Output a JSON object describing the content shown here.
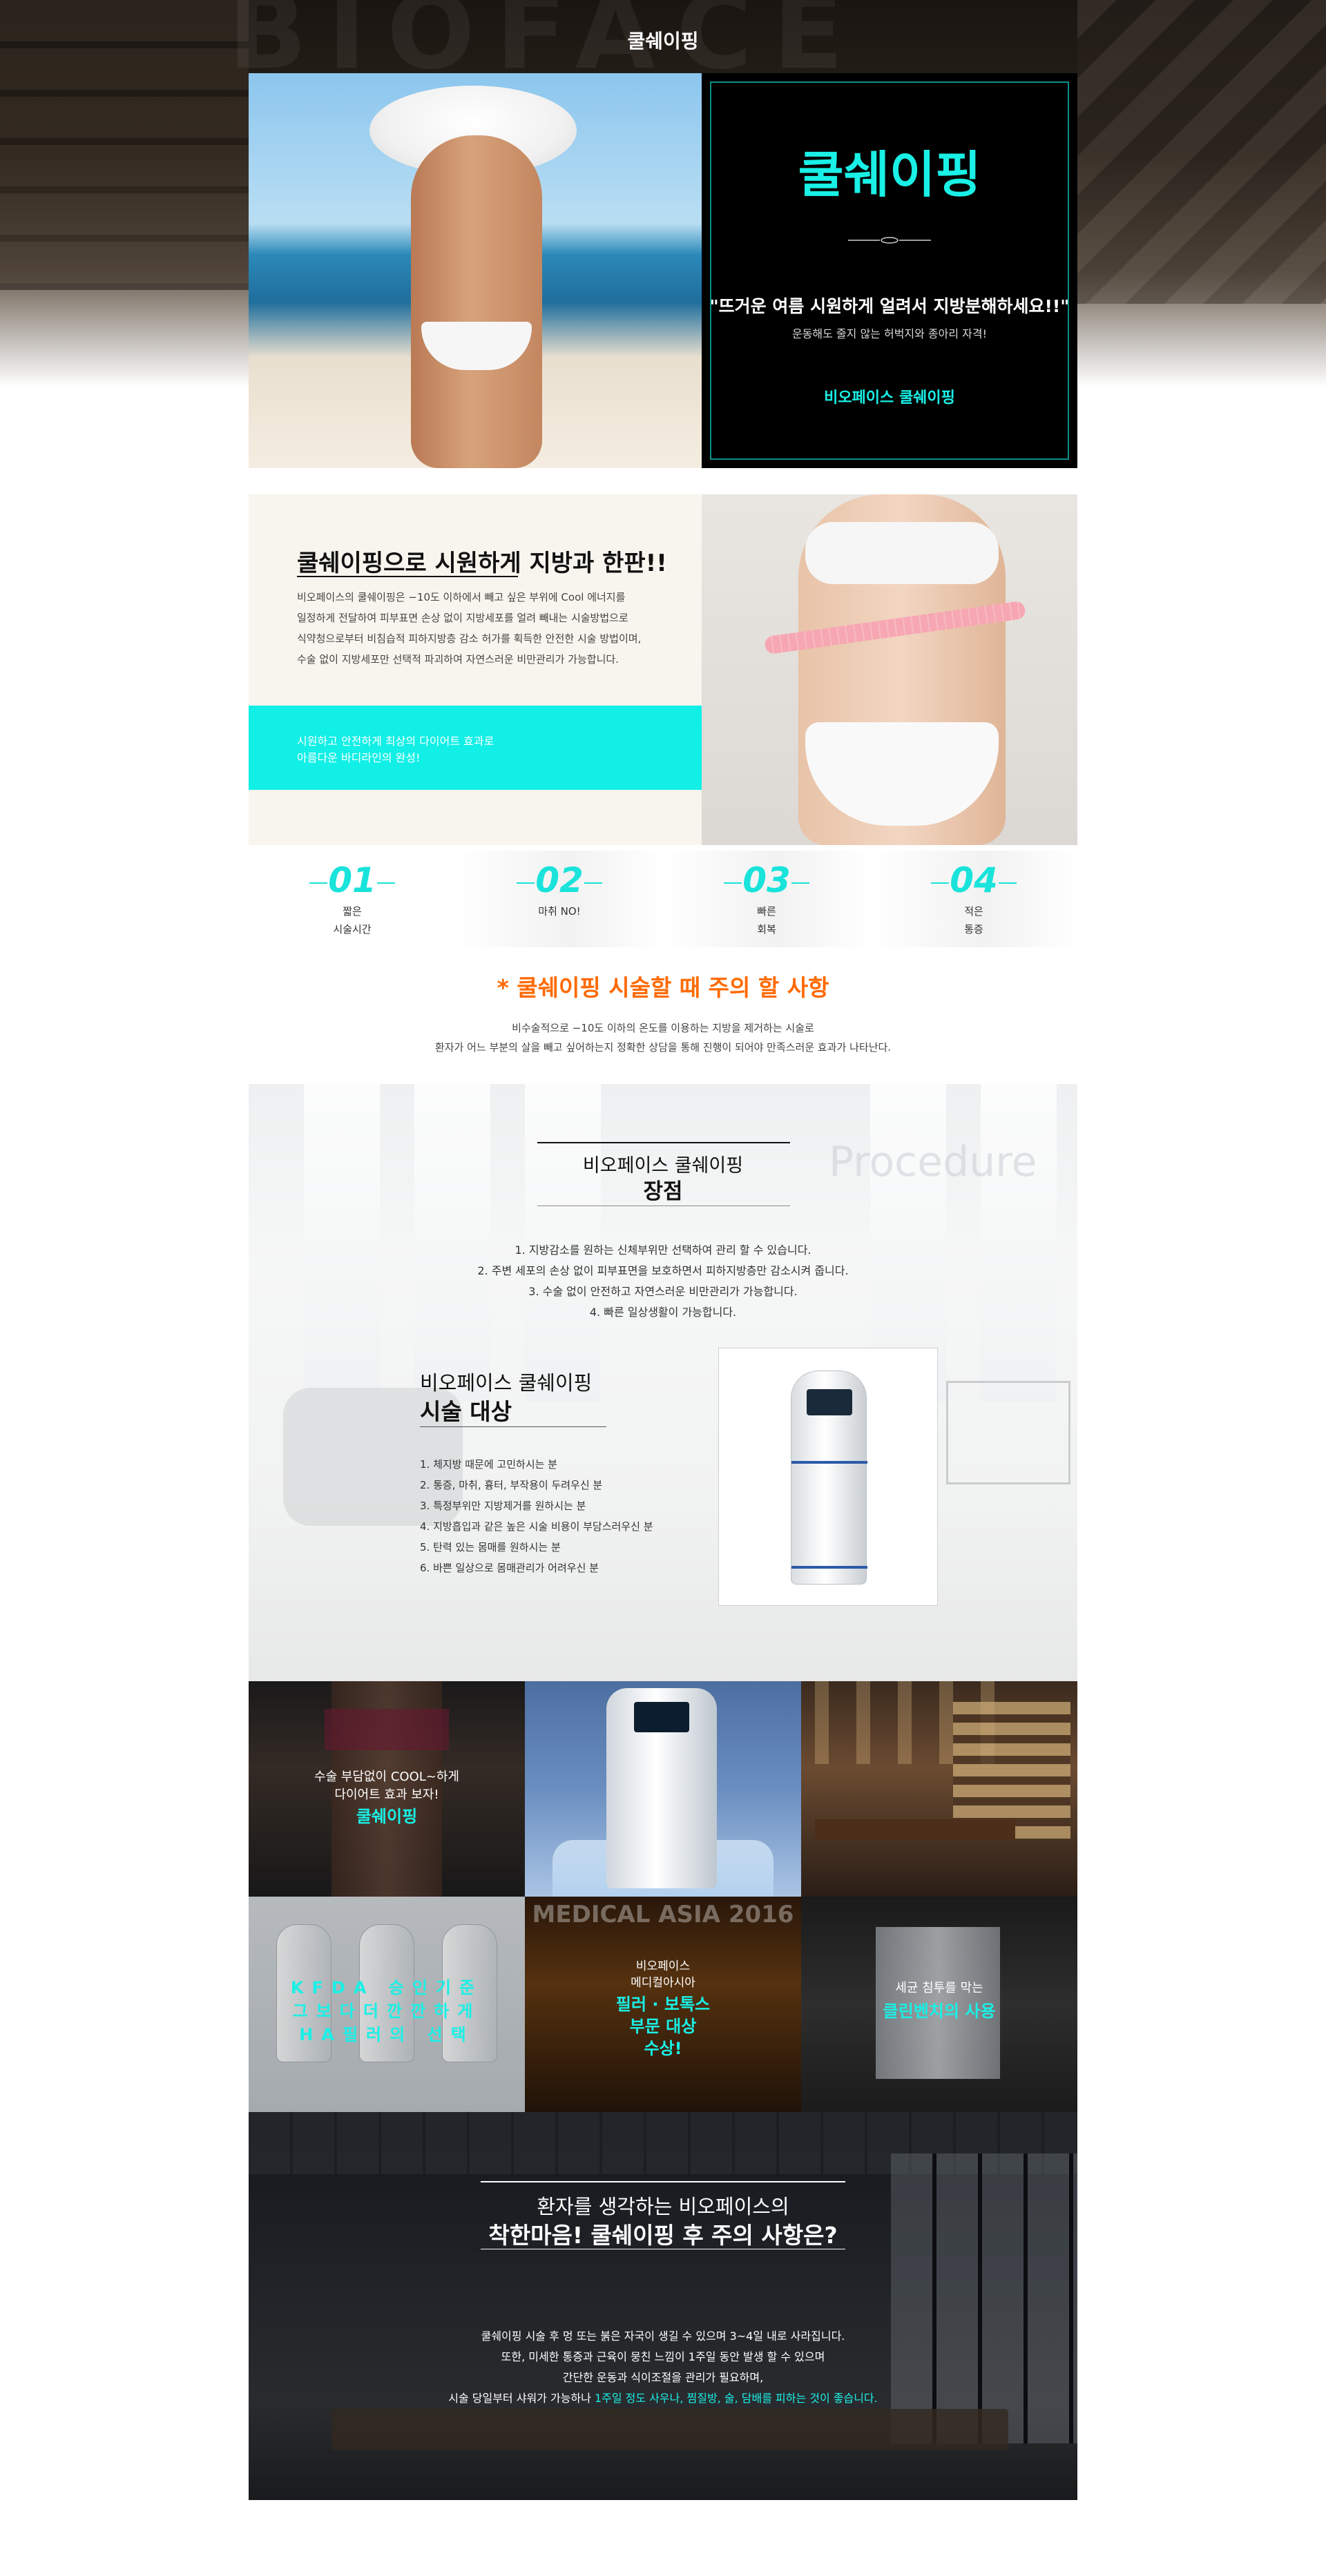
{
  "page": {
    "title": "쿨쉐이핑",
    "background_word": "BIOFACE"
  },
  "hero": {
    "title": "쿨쉐이핑",
    "quote": "\"뜨거운 여름 시원하게 얼려서 지방분해하세요!!\"",
    "subtitle": "운동해도 줄지 않는 허벅지와 종아리 자격!",
    "brand": "비오페이스 쿨쉐이핑",
    "colors": {
      "accent": "#19f0e6",
      "frame": "#0b8f8a"
    }
  },
  "intro": {
    "title": "쿨쉐이핑으로 시원하게 지방과 한판!!",
    "body": [
      "비오페이스의 쿨쉐이핑은 −10도 이하에서 빼고 싶은 부위에 Cool 에너지를",
      "일정하게 전달하여 피부표면 손상 없이 지방세포를 얼려 빼내는 시술방법으로",
      "식약청으로부터 비침습적 피하지방층 감소 허가를 획득한 안전한 시술 방법이며,",
      "수술 없이 지방세포만 선택적 파괴하여 자연스러운 비만관리가 가능합니다."
    ],
    "band_lines": [
      "시원하고 안전하게 최상의 다이어트 효과로",
      "아름다운 바디라인의 완성!"
    ]
  },
  "features": [
    {
      "num": "01",
      "label_1": "짧은",
      "label_2": "시술시간"
    },
    {
      "num": "02",
      "label_1": "마취 NO!",
      "label_2": ""
    },
    {
      "num": "03",
      "label_1": "빠른",
      "label_2": "회복"
    },
    {
      "num": "04",
      "label_1": "적은",
      "label_2": "통증"
    }
  ],
  "caution": {
    "title": "* 쿨쉐이핑 시술할 때 주의 할 사항",
    "line1": "비수술적으로 −10도 이하의 온도를 이용하는 지방을 제거하는 시술로",
    "line2": "환자가 어느 부분의 살을 빼고 싶어하는지 정확한 상담을 통해 진행이 되어야 만족스러운 효과가 나타난다.",
    "color": "#ff6a00"
  },
  "advantages": {
    "kicker": "비오페이스 쿨쉐이핑",
    "title": "장점",
    "background_word": "Procedure",
    "items": [
      "1. 지방감소를 원하는 신체부위만 선택하여 관리 할 수 있습니다.",
      "2. 주변 세포의 손상 없이 피부표면을 보호하면서 피하지방층만 감소시켜 줍니다.",
      "3. 수술 없이 안전하고 자연스러운 비만관리가 가능합니다.",
      "4. 빠른 일상생활이 가능합니다."
    ]
  },
  "targets": {
    "kicker": "비오페이스 쿨쉐이핑",
    "title": "시술 대상",
    "items": [
      "1. 체지방 때문에 고민하시는 분",
      "2. 통증, 마취, 흉터, 부작용이 두려우신 분",
      "3. 특정부위만 지방제거를 원하시는 분",
      "4. 지방흡입과 같은 높은 시술 비용이 부담스러우신 분",
      "5. 탄력 있는 몸매를 원하시는 분",
      "6. 바쁜 일상으로 몸매관리가 어려우신 분"
    ]
  },
  "grid": {
    "tile1": {
      "line1": "수술 부담없이 COOL~하게",
      "line2": "다이어트 효과 보자!",
      "highlight": "쿨쉐이핑"
    },
    "tile4": {
      "line1": "KFDA 승인기준",
      "line2": "그보다더깐깐하게",
      "line3": "HA필러의 선택"
    },
    "tile5": {
      "banner": "MEDICAL ASIA 2016",
      "line1": "비오페이스",
      "line2": "메디컬아시아",
      "line3": "필러 · 보톡스",
      "line4": "부문 대상",
      "line5": "수상!"
    },
    "tile6": {
      "line1": "세균 침투를 막는",
      "line2": "클린벤치의 사용"
    }
  },
  "final": {
    "kicker": "환자를 생각하는 비오페이스의",
    "title": "착한마음! 쿨쉐이핑 후 주의 사항은?",
    "body": [
      "쿨쉐이핑 시술 후 멍 또는 붉은 자국이 생길 수 있으며 3~4일 내로 사라집니다.",
      "또한, 미세한 통증과 근육이 뭉친 느낌이 1주일 동안 발생 할 수 있으며",
      "간단한 운동과 식이조절을 관리가 필요하며,"
    ],
    "last_prefix": "시술 당일부터 샤워가 가능하나 ",
    "last_highlight": "1주일 정도 사우나, 찜질방, 술, 담배를 피하는 것이 좋습니다."
  }
}
